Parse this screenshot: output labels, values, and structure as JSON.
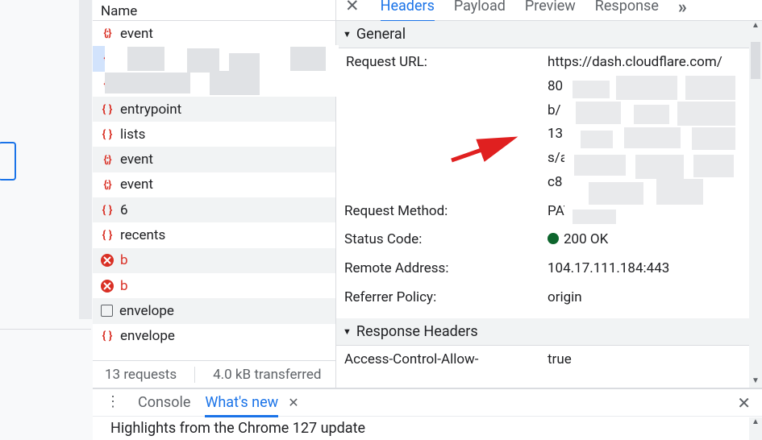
{
  "nameHeader": "Name",
  "rows": [
    {
      "icon": "js",
      "label": "event",
      "alt": false
    },
    {
      "icon": "js",
      "label": "",
      "alt": true,
      "selected": true
    },
    {
      "icon": "js",
      "label": "",
      "alt": false
    },
    {
      "icon": "fetch",
      "label": "entrypoint",
      "alt": true
    },
    {
      "icon": "fetch",
      "label": "lists",
      "alt": false
    },
    {
      "icon": "js",
      "label": "event",
      "alt": true
    },
    {
      "icon": "js",
      "label": "event",
      "alt": false
    },
    {
      "icon": "fetch",
      "label": "6",
      "alt": true
    },
    {
      "icon": "fetch",
      "label": "recents",
      "alt": false
    },
    {
      "icon": "error",
      "label": "b",
      "alt": true,
      "error": true
    },
    {
      "icon": "error",
      "label": "b",
      "alt": false,
      "error": true
    },
    {
      "icon": "checkbox",
      "label": "envelope",
      "alt": true
    },
    {
      "icon": "fetch",
      "label": "envelope",
      "alt": false
    }
  ],
  "summary": {
    "requests": "13 requests",
    "transferred": "4.0 kB transferred"
  },
  "tabs": {
    "close": "✕",
    "items": [
      "Headers",
      "Payload",
      "Preview",
      "Response"
    ],
    "activeIndex": 0,
    "overflow": "»"
  },
  "general": {
    "title": "General",
    "fields": {
      "requestUrlLabel": "Request URL:",
      "requestUrlValue": "https://dash.cloudflare.com/",
      "urlFragments": [
        "80",
        "b/",
        "13",
        "s/a",
        "c8"
      ],
      "requestMethodLabel": "Request Method:",
      "requestMethodValue": "PATCH",
      "statusCodeLabel": "Status Code:",
      "statusCodeValue": "200 OK",
      "remoteAddressLabel": "Remote Address:",
      "remoteAddressValue": "104.17.111.184:443",
      "referrerPolicyLabel": "Referrer Policy:",
      "referrerPolicyValue": "origin"
    }
  },
  "responseHeaders": {
    "title": "Response Headers",
    "acahLabel": "Access-Control-Allow-",
    "acahValue": "true"
  },
  "drawer": {
    "consoleTab": "Console",
    "whatsNewTab": "What's new",
    "body": "Highlights from the Chrome 127 update"
  },
  "colors": {
    "accent": "#1a73e8",
    "error": "#d93025",
    "success": "#0d652d"
  }
}
